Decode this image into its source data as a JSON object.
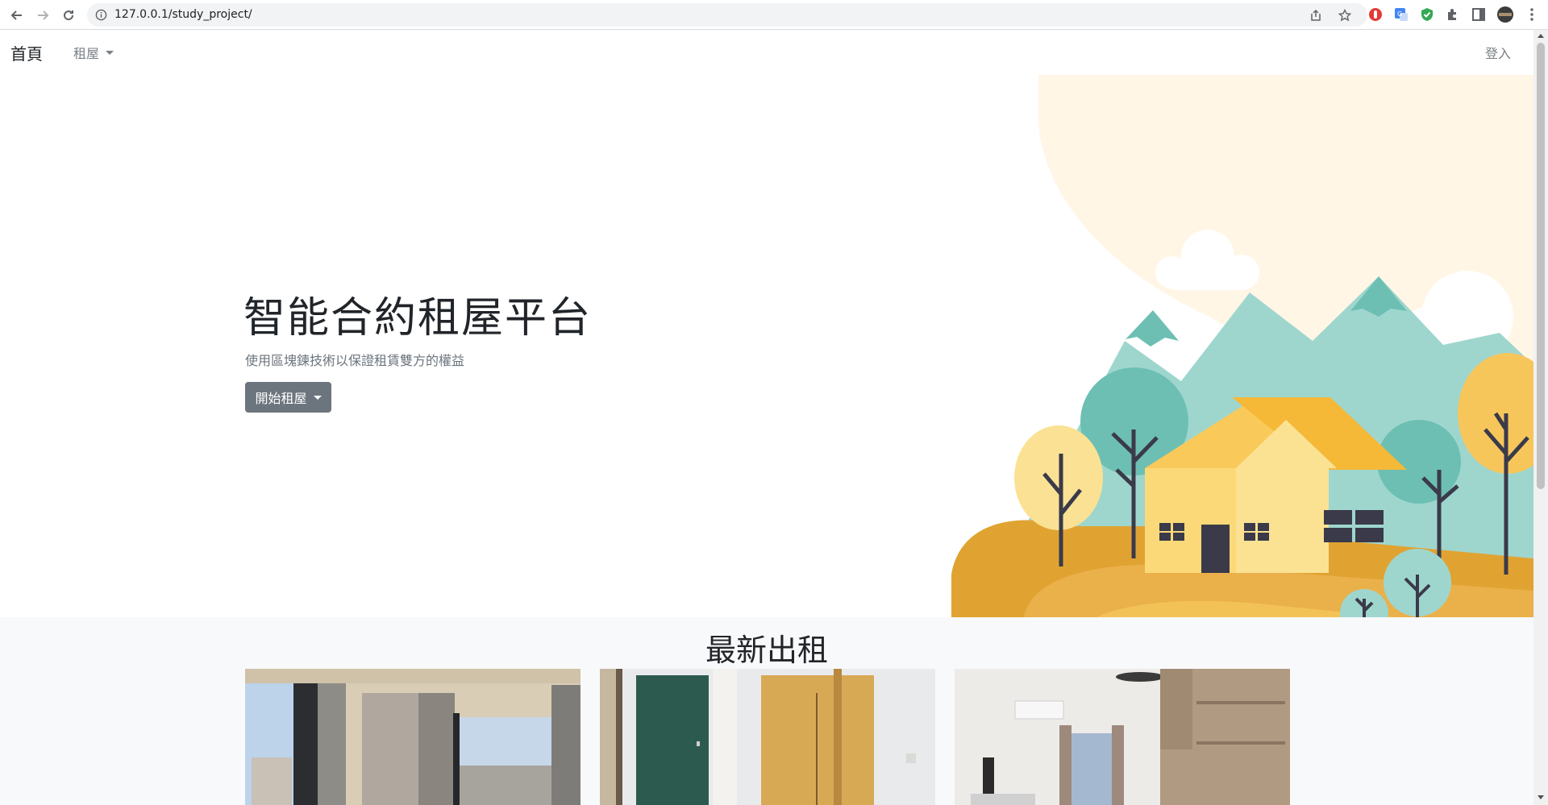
{
  "browser": {
    "url": "127.0.0.1/study_project/"
  },
  "navbar": {
    "brand": "首頁",
    "rent_menu": "租屋",
    "login": "登入"
  },
  "hero": {
    "title": "智能合約租屋平台",
    "subtitle": "使用區塊鍊技術以保證租賃雙方的權益",
    "button_label": "開始租屋"
  },
  "latest": {
    "heading": "最新出租",
    "cards": [
      {
        "image": "room-window-city-view-photo"
      },
      {
        "image": "room-door-wardrobe-photo"
      },
      {
        "image": "room-living-kitchen-photo"
      }
    ]
  },
  "colors": {
    "button": "#6c757d",
    "section_bg": "#f8f9fa",
    "house_yellow": "#f9c95a",
    "hill_teal": "#9ed6ce"
  }
}
